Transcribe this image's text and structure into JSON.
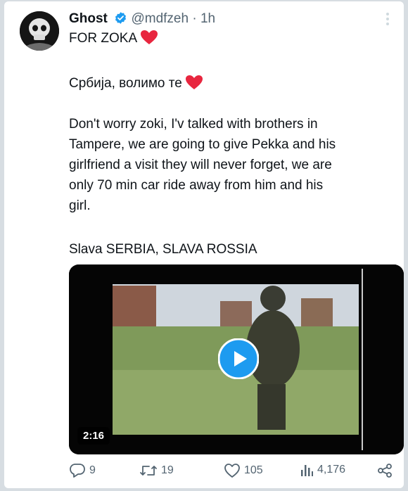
{
  "tweet": {
    "author_name": "Ghost",
    "author_handle": "@mdfzeh",
    "separator": "·",
    "time": "1h",
    "line1": "FOR ZOKA",
    "line2": "Србија, волимо те",
    "paragraph": [
      "Don't worry zoki, I'v talked with brothers in",
      "Tampere, we are going to give Pekka and his",
      "girlfriend a visit they will never forget, we are",
      "only 70 min car ride away from him and his",
      "girl."
    ],
    "closing": "Slava SERBIA, SLAVA ROSSIA",
    "video_duration": "2:16"
  },
  "actions": {
    "replies": "9",
    "retweets": "19",
    "likes": "105",
    "views": "4,176"
  },
  "colors": {
    "heart": "#e8263f",
    "verified": "#1d9bf0",
    "play": "#1d9bf0"
  },
  "icons": [
    "verified-badge-icon",
    "heart-emoji",
    "reply-icon",
    "retweet-icon",
    "like-icon",
    "views-icon",
    "share-icon",
    "play-icon",
    "more-icon"
  ]
}
